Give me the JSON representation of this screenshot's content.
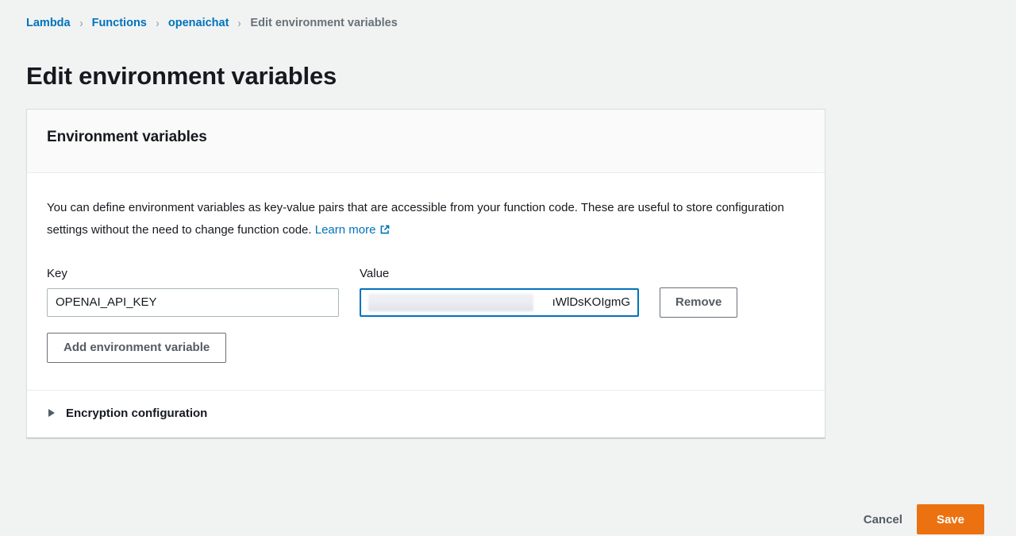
{
  "breadcrumb": {
    "items": [
      {
        "label": "Lambda",
        "current": false
      },
      {
        "label": "Functions",
        "current": false
      },
      {
        "label": "openaichat",
        "current": false
      },
      {
        "label": "Edit environment variables",
        "current": true
      }
    ],
    "separator": "›"
  },
  "page": {
    "title": "Edit environment variables"
  },
  "card": {
    "header_title": "Environment variables",
    "description_part1": "You can define environment variables as key-value pairs that are accessible from your function code. These are useful to store configuration settings without the need to change function code. ",
    "learn_more_label": "Learn more",
    "learn_more_icon": "external-link-icon"
  },
  "form": {
    "key_label": "Key",
    "value_label": "Value",
    "rows": [
      {
        "key_value": "OPENAI_API_KEY",
        "key_placeholder": "",
        "value_value": "ıWlDsKOIgmG",
        "value_placeholder": "",
        "value_redacted": true,
        "remove_label": "Remove"
      }
    ],
    "add_label": "Add environment variable"
  },
  "encryption": {
    "label": "Encryption configuration",
    "expanded": false,
    "caret_icon": "caret-right-icon"
  },
  "actions": {
    "cancel_label": "Cancel",
    "save_label": "Save"
  },
  "colors": {
    "link": "#0073bb",
    "primary": "#ec7211",
    "page_background": "#f1f3f3",
    "card_header_background": "#fafafa",
    "focus_border": "#0073bb",
    "text": "#16191f",
    "muted_text": "#687078"
  }
}
